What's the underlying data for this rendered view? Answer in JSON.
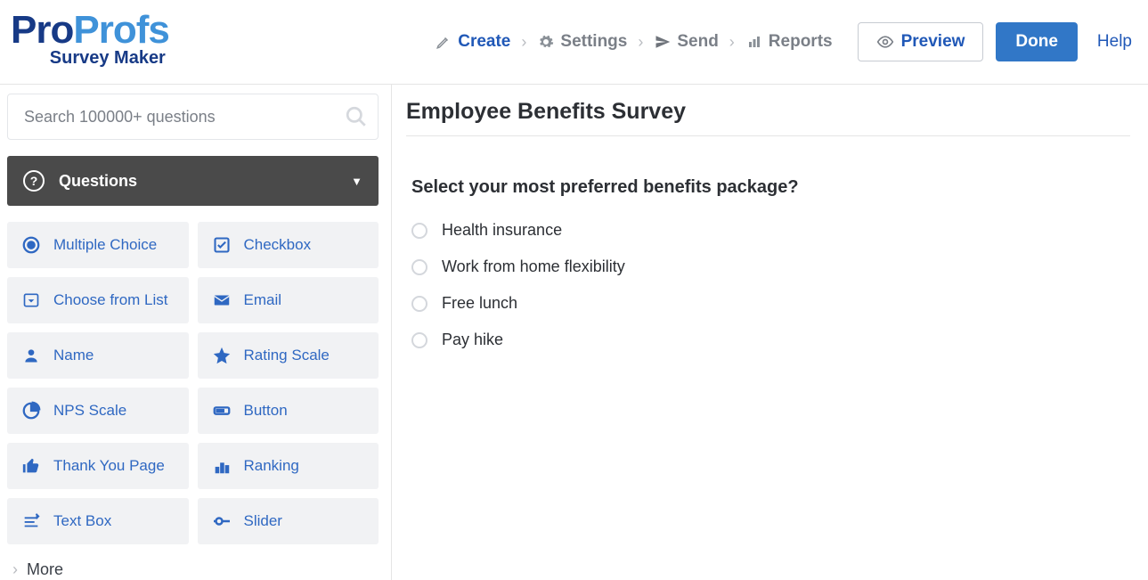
{
  "logo": {
    "pro": "Pro",
    "profs": "Profs",
    "sub": "Survey Maker"
  },
  "nav": {
    "create": "Create",
    "settings": "Settings",
    "send": "Send",
    "reports": "Reports"
  },
  "buttons": {
    "preview": "Preview",
    "done": "Done",
    "help": "Help"
  },
  "search": {
    "placeholder": "Search 100000+ questions"
  },
  "sidebar": {
    "questions_header": "Questions",
    "types": {
      "multiple_choice": "Multiple Choice",
      "checkbox": "Checkbox",
      "choose_from_list": "Choose from List",
      "email": "Email",
      "name": "Name",
      "rating_scale": "Rating Scale",
      "nps_scale": "NPS Scale",
      "button": "Button",
      "thank_you_page": "Thank You Page",
      "ranking": "Ranking",
      "text_box": "Text Box",
      "slider": "Slider"
    },
    "more": "More"
  },
  "survey": {
    "title": "Employee Benefits Survey",
    "question": "Select your most preferred benefits package?",
    "options": [
      "Health insurance",
      "Work from home flexibility",
      "Free lunch",
      "Pay hike"
    ]
  }
}
